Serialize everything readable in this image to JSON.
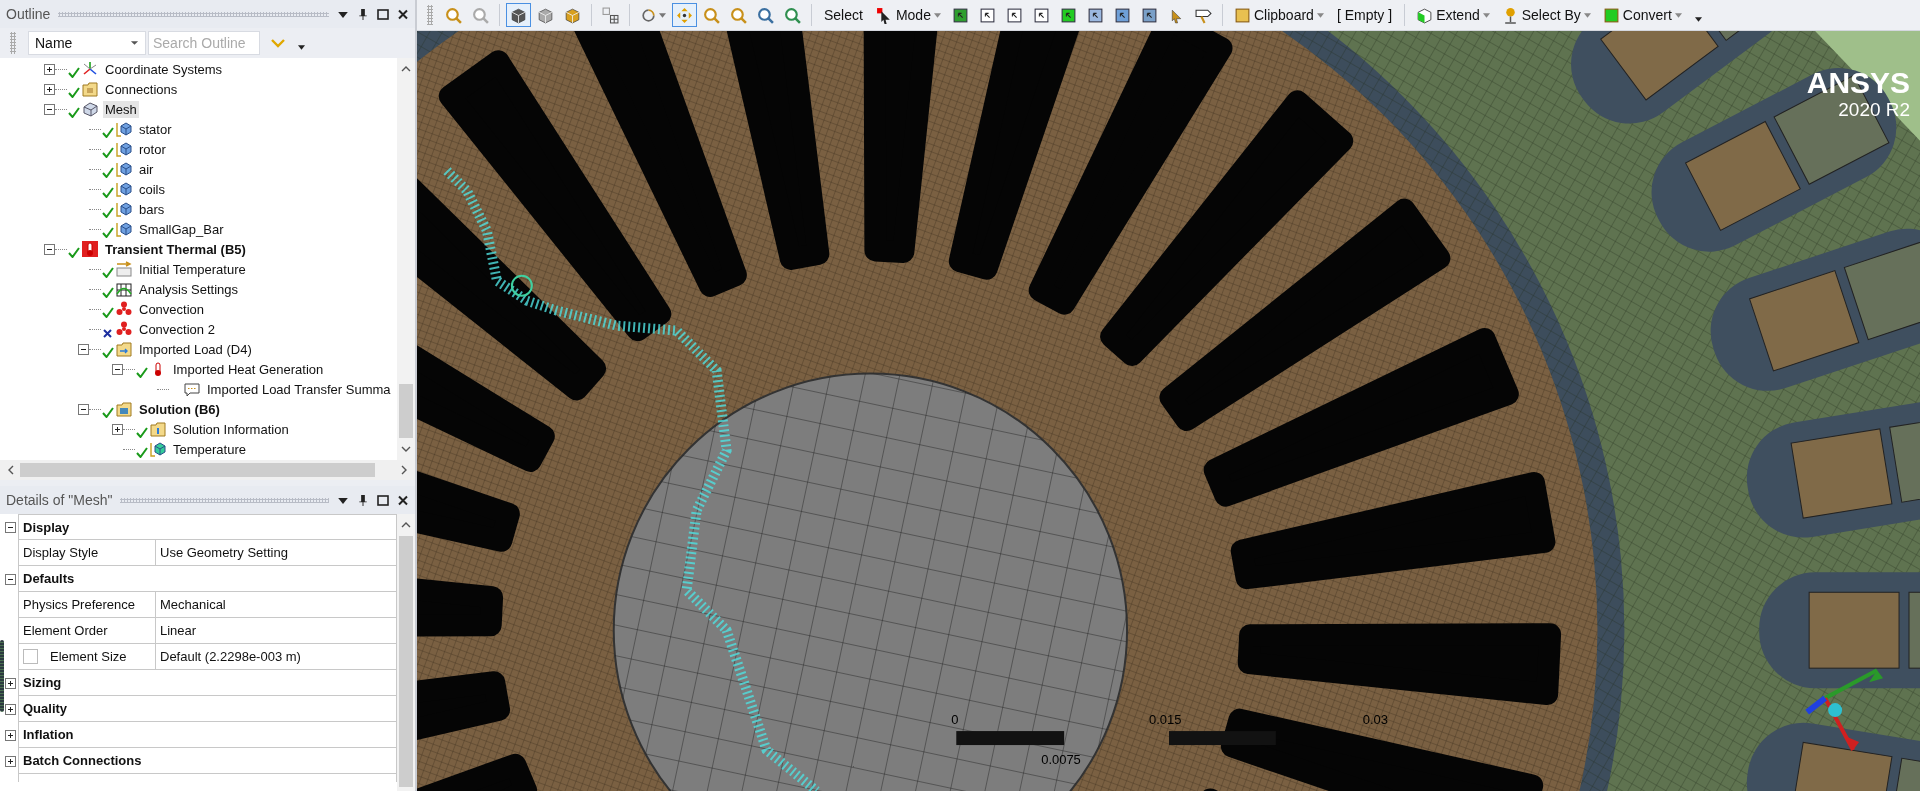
{
  "outline": {
    "title": "Outline",
    "filter": {
      "value": "Name",
      "placeholder": "Search Outline"
    },
    "items": [
      {
        "label": "Coordinate Systems",
        "kind": "axes",
        "valid": true,
        "expanded": false,
        "selected": false
      },
      {
        "label": "Connections",
        "kind": "folder",
        "valid": true,
        "expanded": false,
        "selected": false
      },
      {
        "label": "Mesh",
        "kind": "mesh",
        "valid": true,
        "expanded": true,
        "selected": true,
        "children": [
          {
            "label": "stator",
            "kind": "body",
            "valid": true,
            "selected": false
          },
          {
            "label": "rotor",
            "kind": "body",
            "valid": true,
            "selected": false
          },
          {
            "label": "air",
            "kind": "body",
            "valid": true,
            "selected": false
          },
          {
            "label": "coils",
            "kind": "body",
            "valid": true,
            "selected": false
          },
          {
            "label": "bars",
            "kind": "body",
            "valid": true,
            "selected": false
          },
          {
            "label": "SmallGap_Bar",
            "kind": "body",
            "valid": true,
            "selected": false
          }
        ]
      },
      {
        "label": "Transient Thermal (B5)",
        "kind": "thermal",
        "valid": true,
        "expanded": true,
        "selected": false,
        "bold": true,
        "children": [
          {
            "label": "Initial Temperature",
            "kind": "init",
            "valid": true,
            "selected": false
          },
          {
            "label": "Analysis Settings",
            "kind": "settings",
            "valid": true,
            "selected": false
          },
          {
            "label": "Convection",
            "kind": "fan",
            "valid": true,
            "selected": false
          },
          {
            "label": "Convection 2",
            "kind": "fan",
            "valid": false,
            "selected": false
          },
          {
            "label": "Imported Load (D4)",
            "kind": "import",
            "valid": true,
            "expanded": true,
            "selected": false,
            "children": [
              {
                "label": "Imported Heat Generation",
                "kind": "heat",
                "valid": true,
                "expanded": true,
                "selected": false,
                "children": [
                  {
                    "label": "Imported Load Transfer Summa",
                    "kind": "note",
                    "selected": false
                  }
                ]
              }
            ]
          },
          {
            "label": "Solution (B6)",
            "kind": "solution",
            "valid": true,
            "expanded": true,
            "selected": false,
            "bold": true,
            "children": [
              {
                "label": "Solution Information",
                "kind": "info",
                "valid": true,
                "expanded": false,
                "selected": false
              },
              {
                "label": "Temperature",
                "kind": "temp",
                "valid": true,
                "selected": false
              }
            ]
          }
        ]
      }
    ]
  },
  "details": {
    "title": "Details of \"Mesh\"",
    "rows": [
      {
        "kind": "section",
        "label": "Display",
        "expanded": true
      },
      {
        "kind": "row",
        "label": "Display Style",
        "value": "Use Geometry Setting"
      },
      {
        "kind": "section",
        "label": "Defaults",
        "expanded": true
      },
      {
        "kind": "row",
        "label": "Physics Preference",
        "value": "Mechanical"
      },
      {
        "kind": "row",
        "label": "Element Order",
        "value": "Linear"
      },
      {
        "kind": "check-row",
        "label": "Element Size",
        "value": "Default (2.2298e-003 m)",
        "checked": false
      },
      {
        "kind": "section",
        "label": "Sizing",
        "expanded": false
      },
      {
        "kind": "section",
        "label": "Quality",
        "expanded": false
      },
      {
        "kind": "section",
        "label": "Inflation",
        "expanded": false
      },
      {
        "kind": "section",
        "label": "Batch Connections",
        "expanded": false
      }
    ]
  },
  "toolbar": [
    {
      "kind": "icon",
      "pressed": false
    },
    {
      "kind": "icon",
      "pressed": false
    },
    {
      "kind": "separator"
    },
    {
      "kind": "icon",
      "pressed": true
    },
    {
      "kind": "icon",
      "pressed": false
    },
    {
      "kind": "icon",
      "pressed": false
    },
    {
      "kind": "separator"
    },
    {
      "kind": "icon",
      "pressed": false
    },
    {
      "kind": "separator"
    },
    {
      "kind": "icon",
      "pressed": false,
      "dropdown": true
    },
    {
      "kind": "icon",
      "pressed": true
    },
    {
      "kind": "icon",
      "pressed": false
    },
    {
      "kind": "icon",
      "pressed": false
    },
    {
      "kind": "icon",
      "pressed": false
    },
    {
      "kind": "icon",
      "pressed": false
    },
    {
      "kind": "separator"
    },
    {
      "kind": "text",
      "label": "Select"
    },
    {
      "kind": "menu",
      "label": "Mode",
      "dropdown": true
    },
    {
      "kind": "icon",
      "pressed": false
    },
    {
      "kind": "icon",
      "pressed": false
    },
    {
      "kind": "icon",
      "pressed": false
    },
    {
      "kind": "icon",
      "pressed": false
    },
    {
      "kind": "icon",
      "pressed": false
    },
    {
      "kind": "icon",
      "pressed": false
    },
    {
      "kind": "icon",
      "pressed": false
    },
    {
      "kind": "icon",
      "pressed": false
    },
    {
      "kind": "icon",
      "pressed": false
    },
    {
      "kind": "icon",
      "pressed": false
    },
    {
      "kind": "separator"
    },
    {
      "kind": "menu",
      "label": "Clipboard",
      "dropdown": true
    },
    {
      "kind": "text",
      "label": "[ Empty ]"
    },
    {
      "kind": "separator"
    },
    {
      "kind": "menu",
      "label": "Extend",
      "dropdown": true
    },
    {
      "kind": "menu",
      "label": "Select By",
      "dropdown": true
    },
    {
      "kind": "menu",
      "label": "Convert",
      "dropdown": true
    },
    {
      "kind": "overflow"
    }
  ],
  "viewport": {
    "logo": {
      "name": "ANSYS",
      "version": "2020 R2"
    },
    "scale_bar": {
      "top_labels": [
        "0",
        "0.015",
        "0.03"
      ],
      "bottom_labels": [
        "0.0075"
      ]
    }
  }
}
